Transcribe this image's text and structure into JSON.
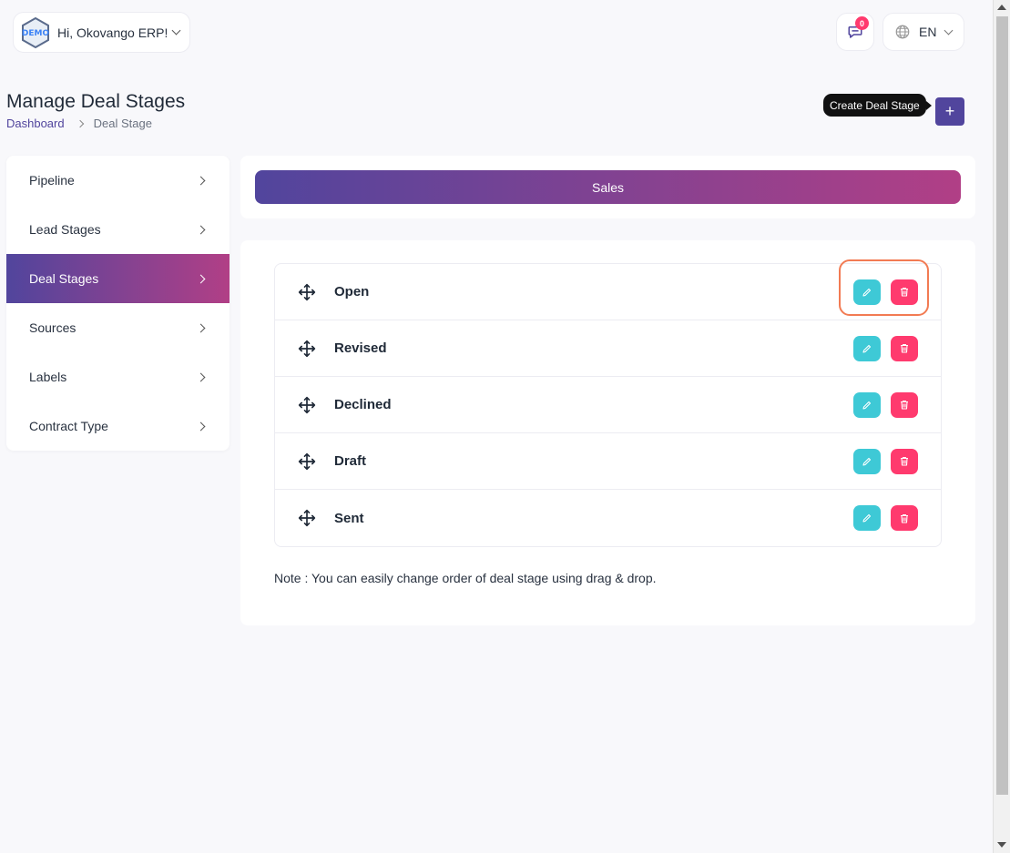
{
  "header": {
    "avatar_text": "DEMO",
    "greeting": "Hi, Okovango ERP!",
    "message_count": "0",
    "language": "EN"
  },
  "page": {
    "title": "Manage Deal Stages",
    "breadcrumb": [
      "Dashboard",
      "Deal Stage"
    ],
    "create_tooltip": "Create Deal Stage",
    "create_button": "+"
  },
  "sidebar": {
    "items": [
      {
        "label": "Pipeline",
        "active": false
      },
      {
        "label": "Lead Stages",
        "active": false
      },
      {
        "label": "Deal Stages",
        "active": true
      },
      {
        "label": "Sources",
        "active": false
      },
      {
        "label": "Labels",
        "active": false
      },
      {
        "label": "Contract Type",
        "active": false
      }
    ]
  },
  "pipeline_tab": "Sales",
  "stages": [
    {
      "name": "Open"
    },
    {
      "name": "Revised"
    },
    {
      "name": "Declined"
    },
    {
      "name": "Draft"
    },
    {
      "name": "Sent"
    }
  ],
  "note": "Note : You can easily change order of deal stage using drag & drop.",
  "colors": {
    "primary": "#51459d",
    "gradient_end": "#b13f86",
    "edit": "#3ec9d6",
    "delete": "#ff3a6e",
    "highlight": "#f27b53"
  }
}
